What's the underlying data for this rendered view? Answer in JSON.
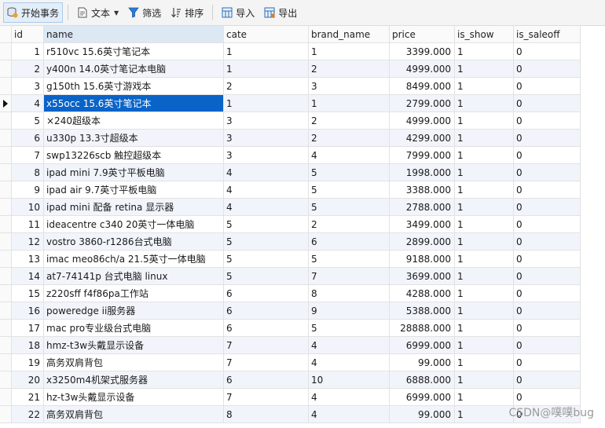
{
  "toolbar": {
    "begin_transaction": "开始事务",
    "text": "文本",
    "filter": "筛选",
    "sort": "排序",
    "import": "导入",
    "export": "导出"
  },
  "columns": [
    "id",
    "name",
    "cate",
    "brand_name",
    "price",
    "is_show",
    "is_saleoff"
  ],
  "selected_row_index": 3,
  "rows": [
    [
      "1",
      "r510vc 15.6英寸笔记本",
      "1",
      "1",
      "3399.000",
      "1",
      "0"
    ],
    [
      "2",
      "y400n 14.0英寸笔记本电脑",
      "1",
      "2",
      "4999.000",
      "1",
      "0"
    ],
    [
      "3",
      "g150th 15.6英寸游戏本",
      "2",
      "3",
      "8499.000",
      "1",
      "0"
    ],
    [
      "4",
      "x55occ 15.6英寸笔记本",
      "1",
      "1",
      "2799.000",
      "1",
      "0"
    ],
    [
      "5",
      "×240超级本",
      "3",
      "2",
      "4999.000",
      "1",
      "0"
    ],
    [
      "6",
      "u330p 13.3寸超级本",
      "3",
      "2",
      "4299.000",
      "1",
      "0"
    ],
    [
      "7",
      "swp13226scb 触控超级本",
      "3",
      "4",
      "7999.000",
      "1",
      "0"
    ],
    [
      "8",
      "ipad mini 7.9英寸平板电脑",
      "4",
      "5",
      "1998.000",
      "1",
      "0"
    ],
    [
      "9",
      "ipad air 9.7英寸平板电脑",
      "4",
      "5",
      "3388.000",
      "1",
      "0"
    ],
    [
      "10",
      "ipad mini 配备 retina 显示器",
      "4",
      "5",
      "2788.000",
      "1",
      "0"
    ],
    [
      "11",
      "ideacentre c340 20英寸一体电脑",
      "5",
      "2",
      "3499.000",
      "1",
      "0"
    ],
    [
      "12",
      "vostro 3860-r1286台式电脑",
      "5",
      "6",
      "2899.000",
      "1",
      "0"
    ],
    [
      "13",
      "imac meo86ch/a 21.5英寸一体电脑",
      "5",
      "5",
      "9188.000",
      "1",
      "0"
    ],
    [
      "14",
      "at7-74141p 台式电脑 linux",
      "5",
      "7",
      "3699.000",
      "1",
      "0"
    ],
    [
      "15",
      "z220sff f4f86pa工作站",
      "6",
      "8",
      "4288.000",
      "1",
      "0"
    ],
    [
      "16",
      "poweredge ii服务器",
      "6",
      "9",
      "5388.000",
      "1",
      "0"
    ],
    [
      "17",
      "mac pro专业级台式电脑",
      "6",
      "5",
      "28888.000",
      "1",
      "0"
    ],
    [
      "18",
      "hmz-t3w头戴显示设备",
      "7",
      "4",
      "6999.000",
      "1",
      "0"
    ],
    [
      "19",
      "高务双肩背包",
      "7",
      "4",
      "99.000",
      "1",
      "0"
    ],
    [
      "20",
      "x3250m4机架式服务器",
      "6",
      "10",
      "6888.000",
      "1",
      "0"
    ],
    [
      "21",
      "hz-t3w头戴显示设备",
      "7",
      "4",
      "6999.000",
      "1",
      "0"
    ],
    [
      "22",
      "高务双肩背包",
      "8",
      "4",
      "99.000",
      "1",
      "0"
    ]
  ],
  "watermark": "CSDN@噗噗bug"
}
